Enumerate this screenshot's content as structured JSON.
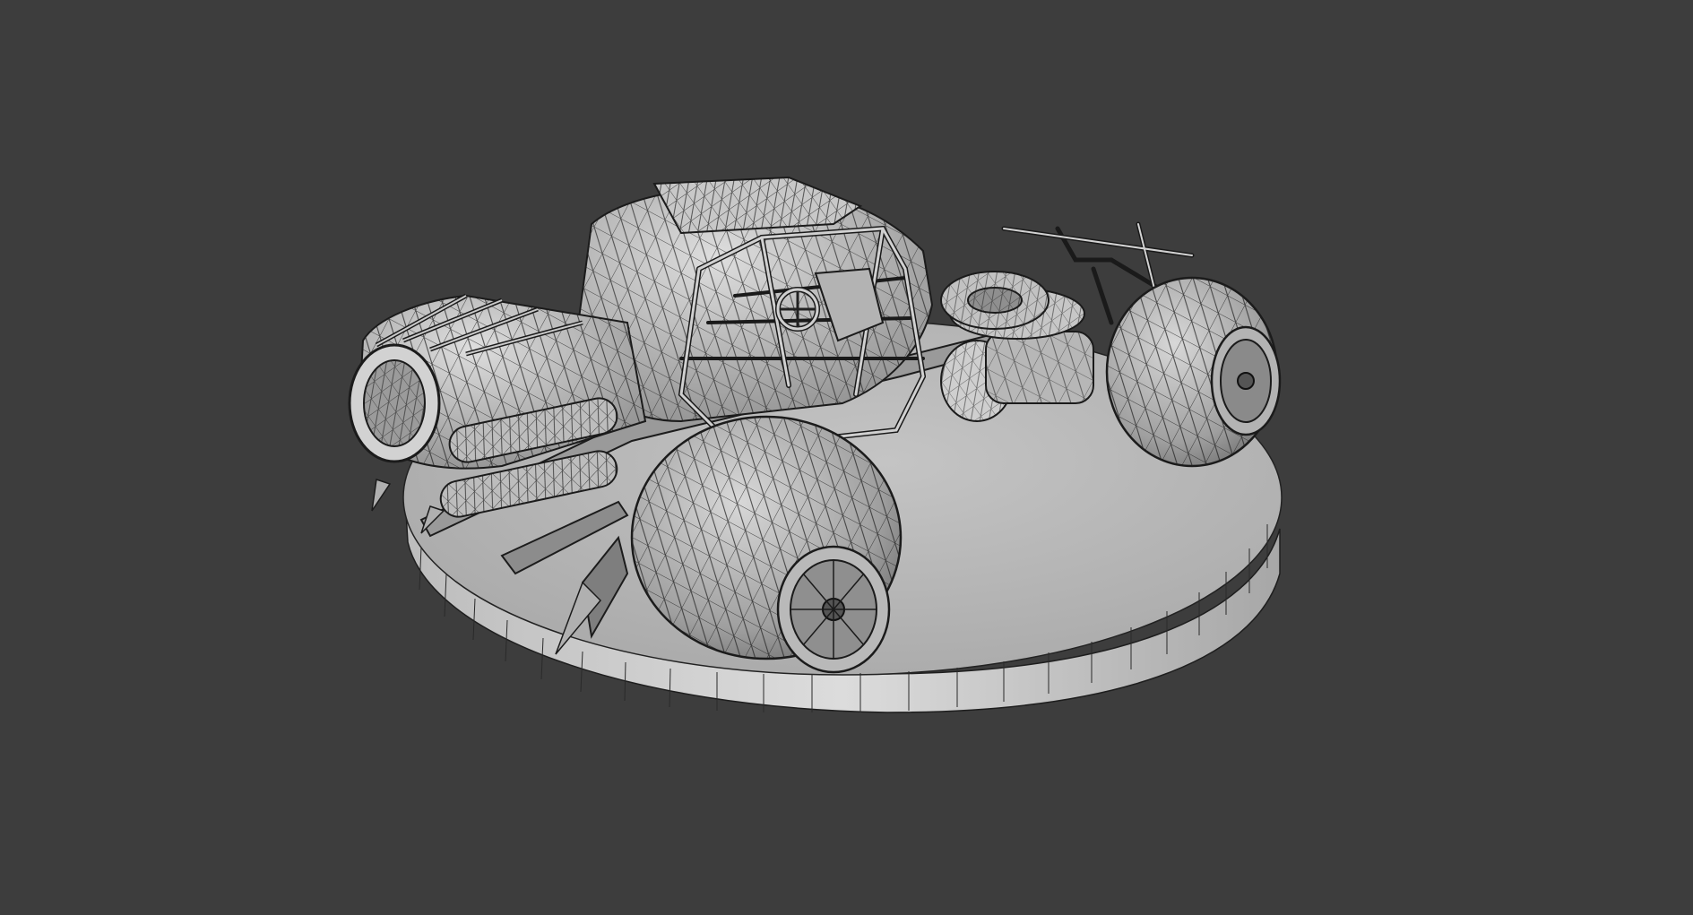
{
  "viewport": {
    "background_color": "#3d3d3d",
    "model_fill": "#a9a9a9",
    "model_highlight": "#d4d4d4",
    "wire_color": "#1c1c1c",
    "pedestal_top_color": "#b4b4b4",
    "pedestal_side_color": "#c8c8c8"
  },
  "scene": {
    "subject": "vehicle-wireframe-model",
    "display_mode": "wireframe-over-solid"
  }
}
